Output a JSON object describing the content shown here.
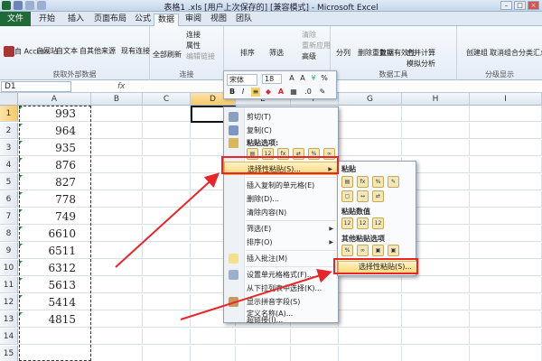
{
  "window": {
    "title": "表格1 .xls  [用户上次保存的]  [兼容模式] - Microsoft Excel"
  },
  "tabs": [
    "文件",
    "开始",
    "插入",
    "页面布局",
    "公式",
    "数据",
    "审阅",
    "视图",
    "团队"
  ],
  "active_tab": "数据",
  "ribbon": {
    "get_external": {
      "items": [
        "自 Access",
        "自网站",
        "自文本",
        "自其他来源",
        "现有连接"
      ],
      "label": "获取外部数据"
    },
    "connections": {
      "refresh": "全部刷新",
      "items": [
        "连接",
        "属性",
        "编辑链接"
      ],
      "label": "连接"
    },
    "sort_filter": {
      "sort": "排序",
      "filter": "筛选",
      "items": [
        "清除",
        "重新应用",
        "高级"
      ]
    },
    "data_tools": {
      "items": [
        "分列",
        "删除重复项",
        "数据有效性",
        "合并计算",
        "模拟分析"
      ],
      "label": "数据工具"
    },
    "outline": {
      "items": [
        "创建组",
        "取消组合",
        "分类汇总"
      ],
      "label": "分级显示"
    }
  },
  "formula_bar": {
    "name_box": "D1",
    "fx": "fx"
  },
  "columns": [
    "A",
    "B",
    "C",
    "D",
    "E",
    "F",
    "G",
    "H",
    "I"
  ],
  "rows": [
    "1",
    "2",
    "3",
    "4",
    "5",
    "6",
    "7",
    "8",
    "9",
    "10",
    "11",
    "12",
    "13",
    "14",
    "15"
  ],
  "column_a_values": [
    "993",
    "964",
    "935",
    "876",
    "827",
    "778",
    "749",
    "6610",
    "6511",
    "6312",
    "5613",
    "5414",
    "4815"
  ],
  "mini_toolbar": {
    "font": "宋体",
    "size": "18",
    "bold": "B",
    "italic": "I"
  },
  "context_menu": {
    "items": [
      "剪切(T)",
      "复制(C)",
      "选择性粘贴(S)...",
      "插入复制的单元格(E)",
      "删除(D)...",
      "清除内容(N)",
      "筛选(E)",
      "排序(O)",
      "插入批注(M)",
      "设置单元格格式(F)...",
      "从下拉列表中选择(K)...",
      "显示拼音字段(S)",
      "定义名称(A)...",
      "超链接(I)..."
    ],
    "paste_options_label": "粘贴选项:"
  },
  "submenu": {
    "paste_label": "粘贴",
    "paste_values_label": "粘贴数值",
    "other_label": "其他粘贴选项",
    "last_item": "选择性粘贴(S)..."
  },
  "colors": {
    "accent_red": "#e8262a",
    "file_tab": "#1e6b35",
    "highlight": "#fbd87a"
  }
}
